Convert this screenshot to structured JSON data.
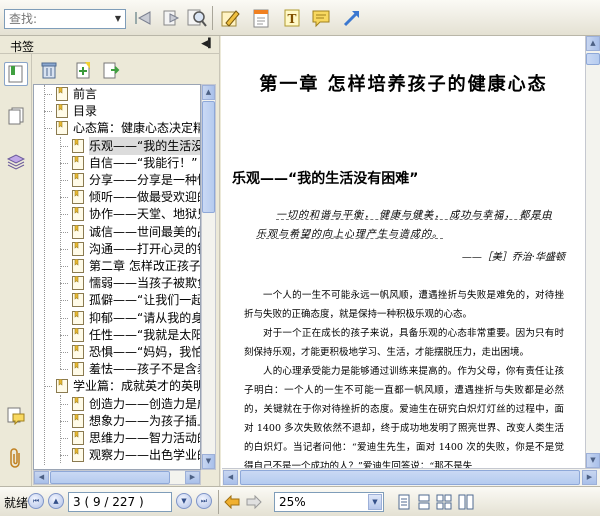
{
  "toolbar": {
    "search_placeholder": "查找:",
    "icons": [
      "prev-result-icon",
      "next-result-icon",
      "find-icon",
      "pencil-icon",
      "notepad-icon",
      "text-tool-icon",
      "comment-icon",
      "arrow-tool-icon"
    ]
  },
  "bookmarks_panel": {
    "title": "书签",
    "items": [
      {
        "label": "前言",
        "level": 1
      },
      {
        "label": "目录",
        "level": 1
      },
      {
        "label": "心态篇：健康心态决定精彩人生",
        "level": 1
      },
      {
        "label": "乐观——“我的生活没有困难”",
        "level": 2,
        "selected": true
      },
      {
        "label": "自信——“我能行！”",
        "level": 2
      },
      {
        "label": "分享——分享是一种快乐",
        "level": 2
      },
      {
        "label": "倾听——做最受欢迎的人",
        "level": 2
      },
      {
        "label": "协作——天堂、地狱只在一念之间",
        "level": 2
      },
      {
        "label": "诚信——世间最美的品德",
        "level": 2
      },
      {
        "label": "沟通——打开心灵的钥匙",
        "level": 2
      },
      {
        "label": "第二章  怎样改正孩子的心态缺陷",
        "level": 2
      },
      {
        "label": "懦弱——当孩子被欺负时",
        "level": 2
      },
      {
        "label": "孤僻——“让我们一起玩吧”",
        "level": 2
      },
      {
        "label": "抑郁——“请从我的身边走开”",
        "level": 2
      },
      {
        "label": "任性——“我就是太阳”",
        "level": 2
      },
      {
        "label": "恐惧——“妈妈，我怕”",
        "level": 2
      },
      {
        "label": "羞怯——孩子不是含羞草",
        "level": 2
      },
      {
        "label": "学业篇：成就英才的英明之举",
        "level": 1
      },
      {
        "label": "创造力——创造力是成功之母",
        "level": 2
      },
      {
        "label": "想象力——为孩子插上想象的翅膀",
        "level": 2
      },
      {
        "label": "思维力——智力活动的核心",
        "level": 2
      },
      {
        "label": "观察力——出色学业的基础",
        "level": 2
      }
    ]
  },
  "document": {
    "chapter_title": "第一章   怎样培养孩子的健康心态",
    "section_title": "乐观——“我的生活没有困难”",
    "quote": "一切的和谐与平衡， 健康与健美， 成功与幸福， 都是由乐观与希望的向上心理产生与造成的。",
    "quote_author": "——［美］乔治·华盛顿",
    "paragraphs": [
      "一个人的一生不可能永远一帆风顺，遭遇挫折与失败是难免的，对待挫折与失败的正确态度，就是保持一种积极乐观的心态。",
      "对于一个正在成长的孩子来说，具备乐观的心态非常重要。因为只有时刻保持乐观，才能更积极地学习、生活，才能摆脱压力，走出困境。",
      "人的心理承受能力是能够通过训练来提高的。作为父母，你有责任让孩子明白：一个人的一生不可能一直都一帆风顺，遭遇挫折与失败都是必然的，关键就在于你对待挫折的态度。爱迪生在研究白炽灯灯丝的过程中，面对 1400 多次失败依然不退却，终于成功地发明了照亮世界、改变人类生活的白炽灯。当记者问他：“爱迪生先生，面对 1400 次的失败，你是不是觉得自己不是一个成功的人？”爱迪生回答说：“那不是失"
    ]
  },
  "statusbar": {
    "status": "就绪",
    "page_display": "3  ( 9 / 227 )",
    "zoom": "25%"
  }
}
